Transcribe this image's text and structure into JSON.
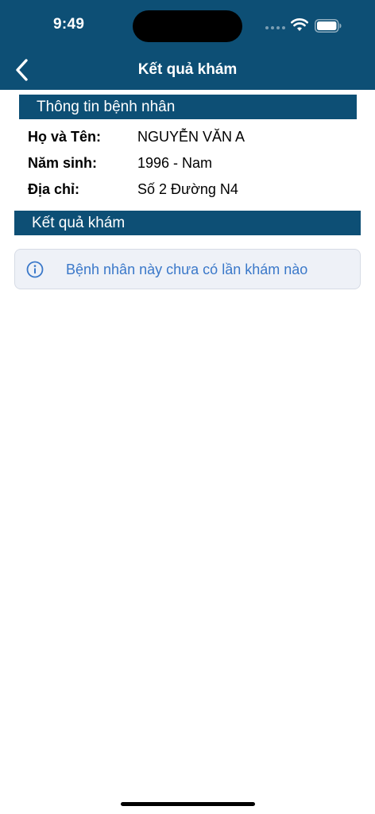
{
  "status_bar": {
    "time": "9:49"
  },
  "nav": {
    "title": "Kết quả khám",
    "back_icon": "chevron-left-icon"
  },
  "patient_section": {
    "title": "Thông tin bệnh nhân",
    "rows": [
      {
        "label": "Họ và Tên:",
        "value": "NGUYỄN VĂN A"
      },
      {
        "label": "Năm sinh:",
        "value": "1996 - Nam"
      },
      {
        "label": "Địa chỉ:",
        "value": "Số 2 Đường N4"
      }
    ]
  },
  "results_section": {
    "title": "Kết quả khám",
    "empty_message": "Bệnh nhân này chưa có lần khám nào",
    "empty_icon": "info-icon"
  },
  "colors": {
    "primary": "#0d4f75",
    "alert_text": "#3a78c9",
    "alert_bg": "#eef1f7"
  }
}
